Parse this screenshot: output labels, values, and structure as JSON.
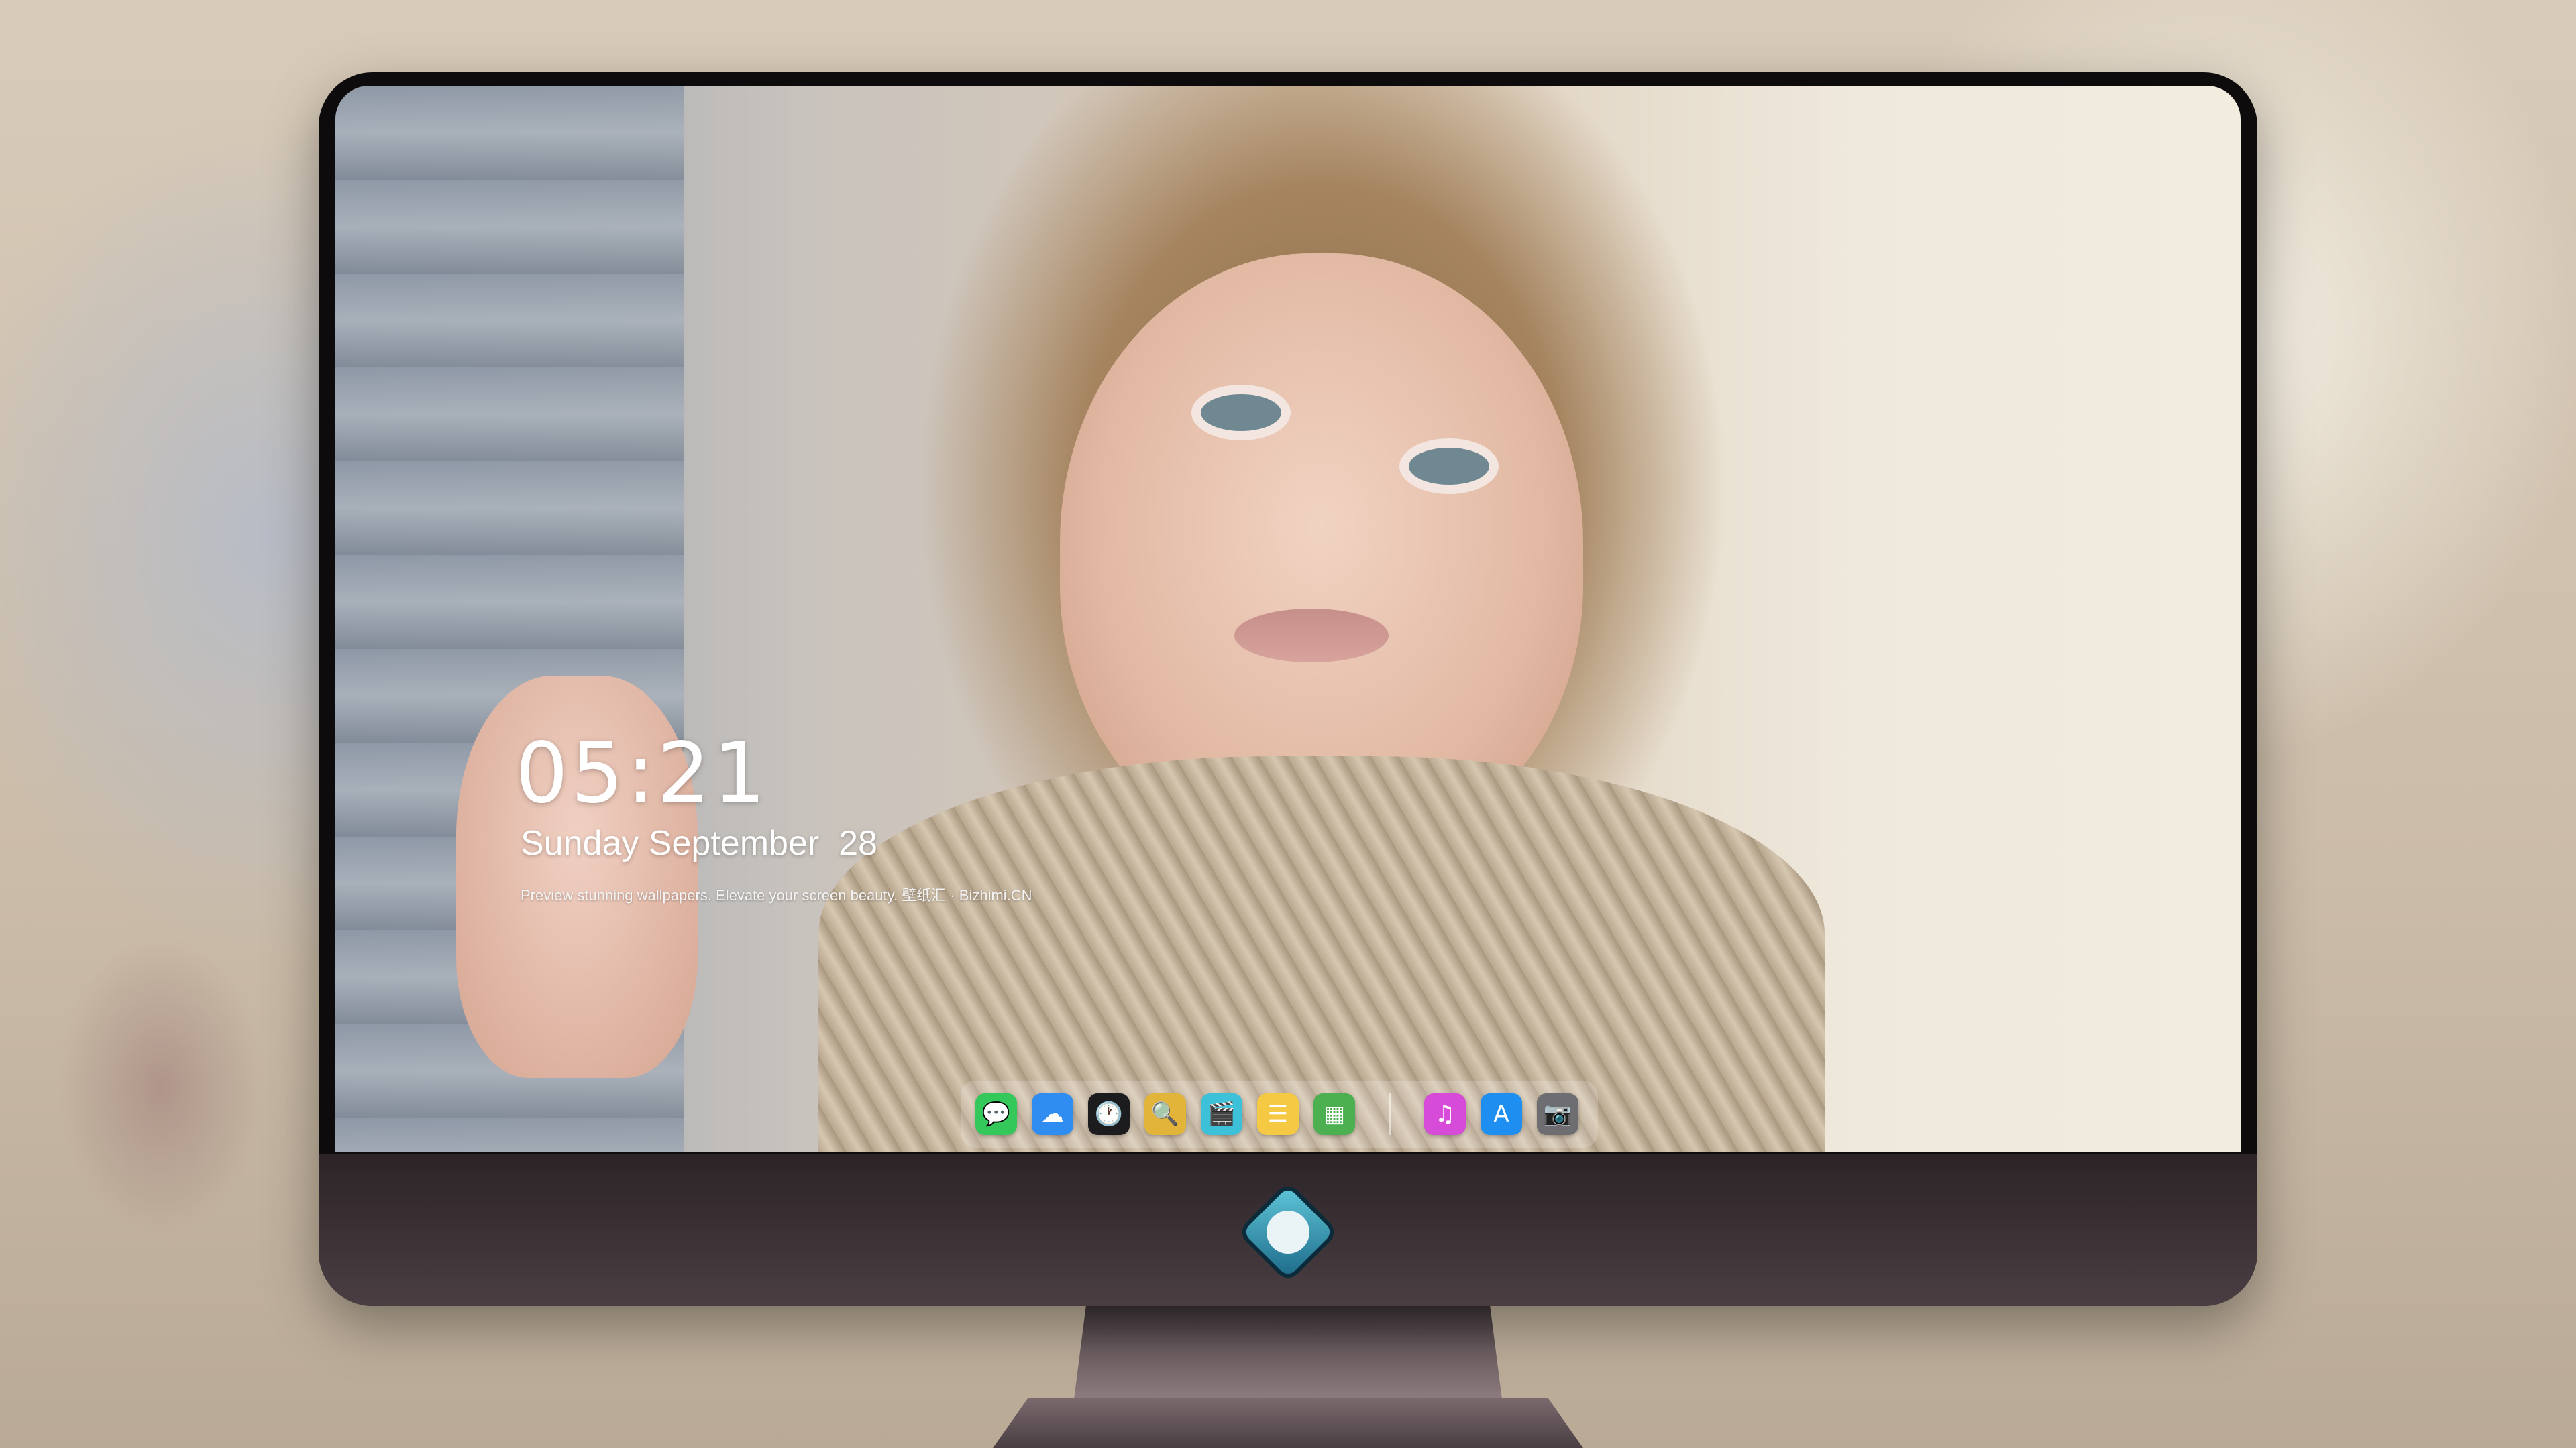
{
  "lockscreen": {
    "time": "05:21",
    "date": "Sunday September  28",
    "tagline": "Preview stunning wallpapers. Elevate your screen beauty. 壁纸汇 · Bizhimi.CN"
  },
  "dock": {
    "apps": [
      {
        "icon": "messages-icon",
        "glyph": "💬",
        "color": "#34c759"
      },
      {
        "icon": "weather-icon",
        "glyph": "☁",
        "color": "#2f8cf0"
      },
      {
        "icon": "clock-icon",
        "glyph": "🕐",
        "color": "#1c1c1e"
      },
      {
        "icon": "preview-icon",
        "glyph": "🔍",
        "color": "#e2b53a"
      },
      {
        "icon": "video-clapper-icon",
        "glyph": "🎬",
        "color": "#3cc1d8"
      },
      {
        "icon": "notes-icon",
        "glyph": "☰",
        "color": "#f6c945"
      },
      {
        "icon": "photo-collage-icon",
        "glyph": "▦",
        "color": "#4caf50"
      },
      {
        "icon": "music-icon",
        "glyph": "♫",
        "color": "#d64bd8"
      },
      {
        "icon": "app-store-icon",
        "glyph": "A",
        "color": "#1e8ef0"
      },
      {
        "icon": "camera-icon",
        "glyph": "📷",
        "color": "#6d6d72"
      }
    ]
  }
}
